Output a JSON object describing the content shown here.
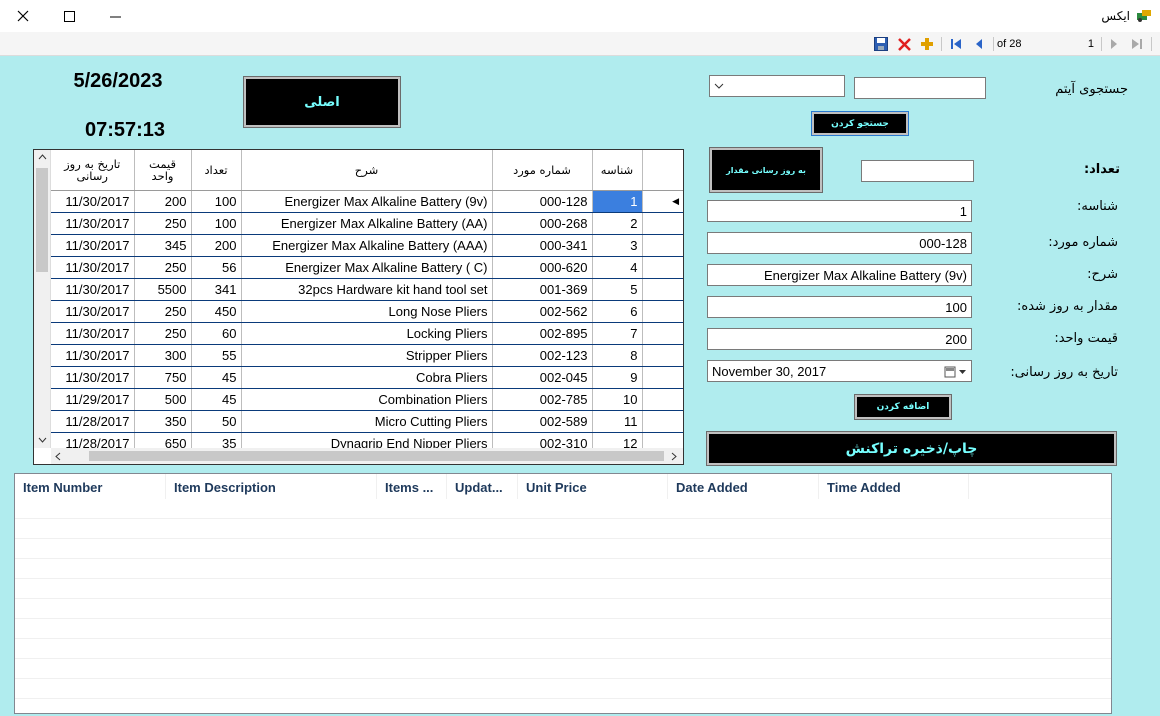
{
  "window": {
    "title": "ایکس"
  },
  "toolbar": {
    "position": "1",
    "of_label": "of 28"
  },
  "main": {
    "date": "5/26/2023",
    "time": "07:57:13",
    "main_button": "اصلی",
    "search_label": "جستجوی آیتم",
    "search_button": "جستجو کردن",
    "update_qty_button": "به روز رسانی مقدار",
    "add_button": "اضافه کردن",
    "print_button": "چاپ/ذخیره تراکنش",
    "labels": {
      "count": "تعداد:",
      "id": "شناسه:",
      "item_number": "شماره مورد:",
      "description": "شرح:",
      "updated_qty": "مقدار به روز شده:",
      "unit_price": "قیمت واحد:",
      "update_date": "تاریخ به روز رسانی:"
    },
    "fields": {
      "id": "1",
      "item_number": "000-128",
      "description": "Energizer Max Alkaline Battery (9v)",
      "updated_qty": "100",
      "unit_price": "200",
      "update_date": "November 30, 2017"
    }
  },
  "grid": {
    "headers": {
      "id": "شناسه",
      "item_number": "شماره مورد",
      "description": "شرح",
      "qty": "تعداد",
      "price": "قیمت واحد",
      "date": "تاریخ به روز رسانی"
    },
    "rows": [
      {
        "date": "11/30/2017",
        "price": "200",
        "qty": "100",
        "desc": "Energizer Max Alkaline Battery (9v)",
        "num": "000-128",
        "id": "1"
      },
      {
        "date": "11/30/2017",
        "price": "250",
        "qty": "100",
        "desc": "Energizer Max Alkaline Battery (AA)",
        "num": "000-268",
        "id": "2"
      },
      {
        "date": "11/30/2017",
        "price": "345",
        "qty": "200",
        "desc": "Energizer Max Alkaline Battery (AAA)",
        "num": "000-341",
        "id": "3"
      },
      {
        "date": "11/30/2017",
        "price": "250",
        "qty": "56",
        "desc": "Energizer Max Alkaline Battery ( C)",
        "num": "000-620",
        "id": "4"
      },
      {
        "date": "11/30/2017",
        "price": "5500",
        "qty": "341",
        "desc": "32pcs Hardware kit hand tool set",
        "num": "001-369",
        "id": "5"
      },
      {
        "date": "11/30/2017",
        "price": "250",
        "qty": "450",
        "desc": "Long Nose Pliers",
        "num": "002-562",
        "id": "6"
      },
      {
        "date": "11/30/2017",
        "price": "250",
        "qty": "60",
        "desc": "Locking Pliers",
        "num": "002-895",
        "id": "7"
      },
      {
        "date": "11/30/2017",
        "price": "300",
        "qty": "55",
        "desc": "Stripper Pliers",
        "num": "002-123",
        "id": "8"
      },
      {
        "date": "11/30/2017",
        "price": "750",
        "qty": "45",
        "desc": "Cobra Pliers",
        "num": "002-045",
        "id": "9"
      },
      {
        "date": "11/29/2017",
        "price": "500",
        "qty": "45",
        "desc": "Combination Pliers",
        "num": "002-785",
        "id": "10"
      },
      {
        "date": "11/28/2017",
        "price": "350",
        "qty": "50",
        "desc": "Micro Cutting Pliers",
        "num": "002-589",
        "id": "11"
      },
      {
        "date": "11/28/2017",
        "price": "650",
        "qty": "35",
        "desc": "Dynagrip End Nipper Pliers",
        "num": "002-310",
        "id": "12"
      }
    ]
  },
  "transactions": {
    "columns": [
      "Item Number",
      "Item Description",
      "Items ...",
      "Updat...",
      "Unit Price",
      "Date Added",
      "Time Added"
    ]
  },
  "colors": {
    "background": "#b0ecee",
    "button_bg": "#000000",
    "button_text": "#7fffff",
    "selection": "#3b7fdf"
  }
}
